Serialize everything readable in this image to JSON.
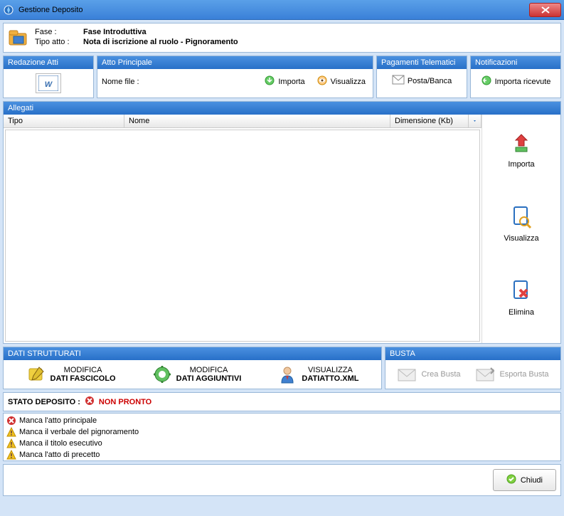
{
  "window": {
    "title": "Gestione Deposito"
  },
  "header": {
    "fase_label": "Fase :",
    "fase_value": "Fase Introduttiva",
    "tipo_label": "Tipo atto :",
    "tipo_value": "Nota di iscrizione al ruolo - Pignoramento"
  },
  "redazione": {
    "title": "Redazione Atti"
  },
  "atto": {
    "title": "Atto Principale",
    "nome_file_label": "Nome file :",
    "importa": "Importa",
    "visualizza": "Visualizza"
  },
  "pagamenti": {
    "title": "Pagamenti Telematici",
    "button": "Posta/Banca"
  },
  "notificazioni": {
    "title": "Notificazioni",
    "button": "Importa ricevute"
  },
  "allegati": {
    "title": "Allegati",
    "cols": {
      "tipo": "Tipo",
      "nome": "Nome",
      "dim": "Dimensione (Kb)"
    },
    "side": {
      "importa": "Importa",
      "visualizza": "Visualizza",
      "elimina": "Elimina"
    }
  },
  "dati": {
    "title": "DATI STRUTTURATI",
    "b1": {
      "l1": "MODIFICA",
      "l2": "DATI FASCICOLO"
    },
    "b2": {
      "l1": "MODIFICA",
      "l2": "DATI AGGIUNTIVI"
    },
    "b3": {
      "l1": "VISUALIZZA",
      "l2": "DATIATTO.XML"
    }
  },
  "busta": {
    "title": "BUSTA",
    "crea": "Crea Busta",
    "esporta": "Esporta Busta"
  },
  "stato": {
    "label": "STATO DEPOSITO :",
    "value": "NON PRONTO"
  },
  "messages": [
    {
      "type": "error",
      "text": "Manca l'atto principale"
    },
    {
      "type": "warn",
      "text": "Manca il verbale del pignoramento"
    },
    {
      "type": "warn",
      "text": "Manca il titolo esecutivo"
    },
    {
      "type": "warn",
      "text": "Manca l'atto di precetto"
    }
  ],
  "footer": {
    "chiudi": "Chiudi"
  }
}
